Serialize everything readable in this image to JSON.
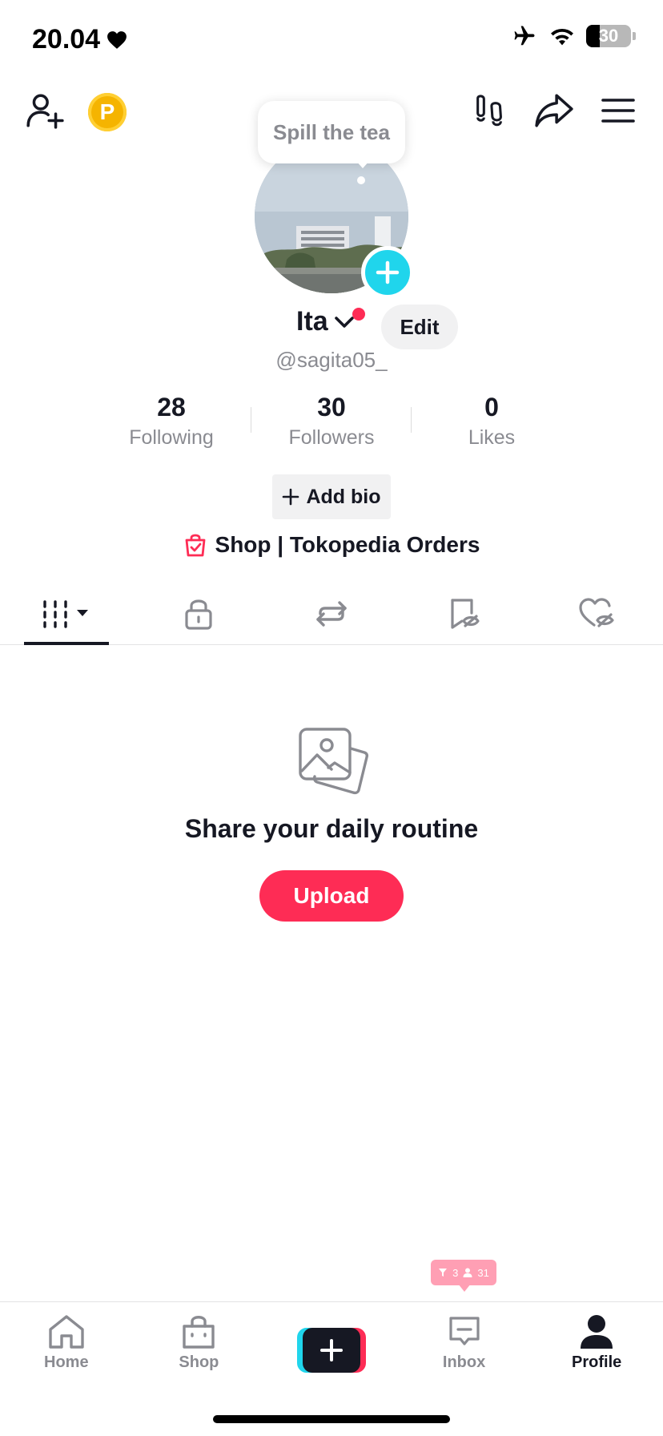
{
  "status_bar": {
    "time": "20.04",
    "battery": "30"
  },
  "header": {
    "coin_label": "P"
  },
  "tooltip": {
    "text": "Spill the tea"
  },
  "profile": {
    "name": "Ita",
    "edit_label": "Edit",
    "handle": "@sagita05_",
    "stats": [
      {
        "value": "28",
        "label": "Following"
      },
      {
        "value": "30",
        "label": "Followers"
      },
      {
        "value": "0",
        "label": "Likes"
      }
    ],
    "add_bio_label": "Add bio",
    "shop_label": "Shop | Tokopedia Orders"
  },
  "empty_state": {
    "title": "Share your daily routine",
    "upload_label": "Upload"
  },
  "notification": {
    "filter_count": "3",
    "followers_count": "31"
  },
  "bottom_nav": {
    "items": [
      {
        "label": "Home"
      },
      {
        "label": "Shop"
      },
      {
        "label": "Inbox"
      },
      {
        "label": "Profile"
      }
    ]
  },
  "colors": {
    "accent_pink": "#fe2c55",
    "accent_cyan": "#20d5ec",
    "text_dark": "#161823",
    "text_muted": "#8a8b91"
  },
  "icons": [
    "heart-icon",
    "airplane-icon",
    "wifi-icon",
    "battery-icon",
    "add-friend-icon",
    "coin-icon",
    "footprints-icon",
    "share-icon",
    "menu-icon",
    "plus-icon",
    "chevron-down-icon",
    "shopping-bag-icon",
    "videos-grid-icon",
    "lock-icon",
    "repost-icon",
    "favorites-hidden-icon",
    "liked-hidden-icon",
    "photos-icon",
    "home-icon",
    "shop-icon",
    "inbox-icon",
    "profile-icon"
  ]
}
